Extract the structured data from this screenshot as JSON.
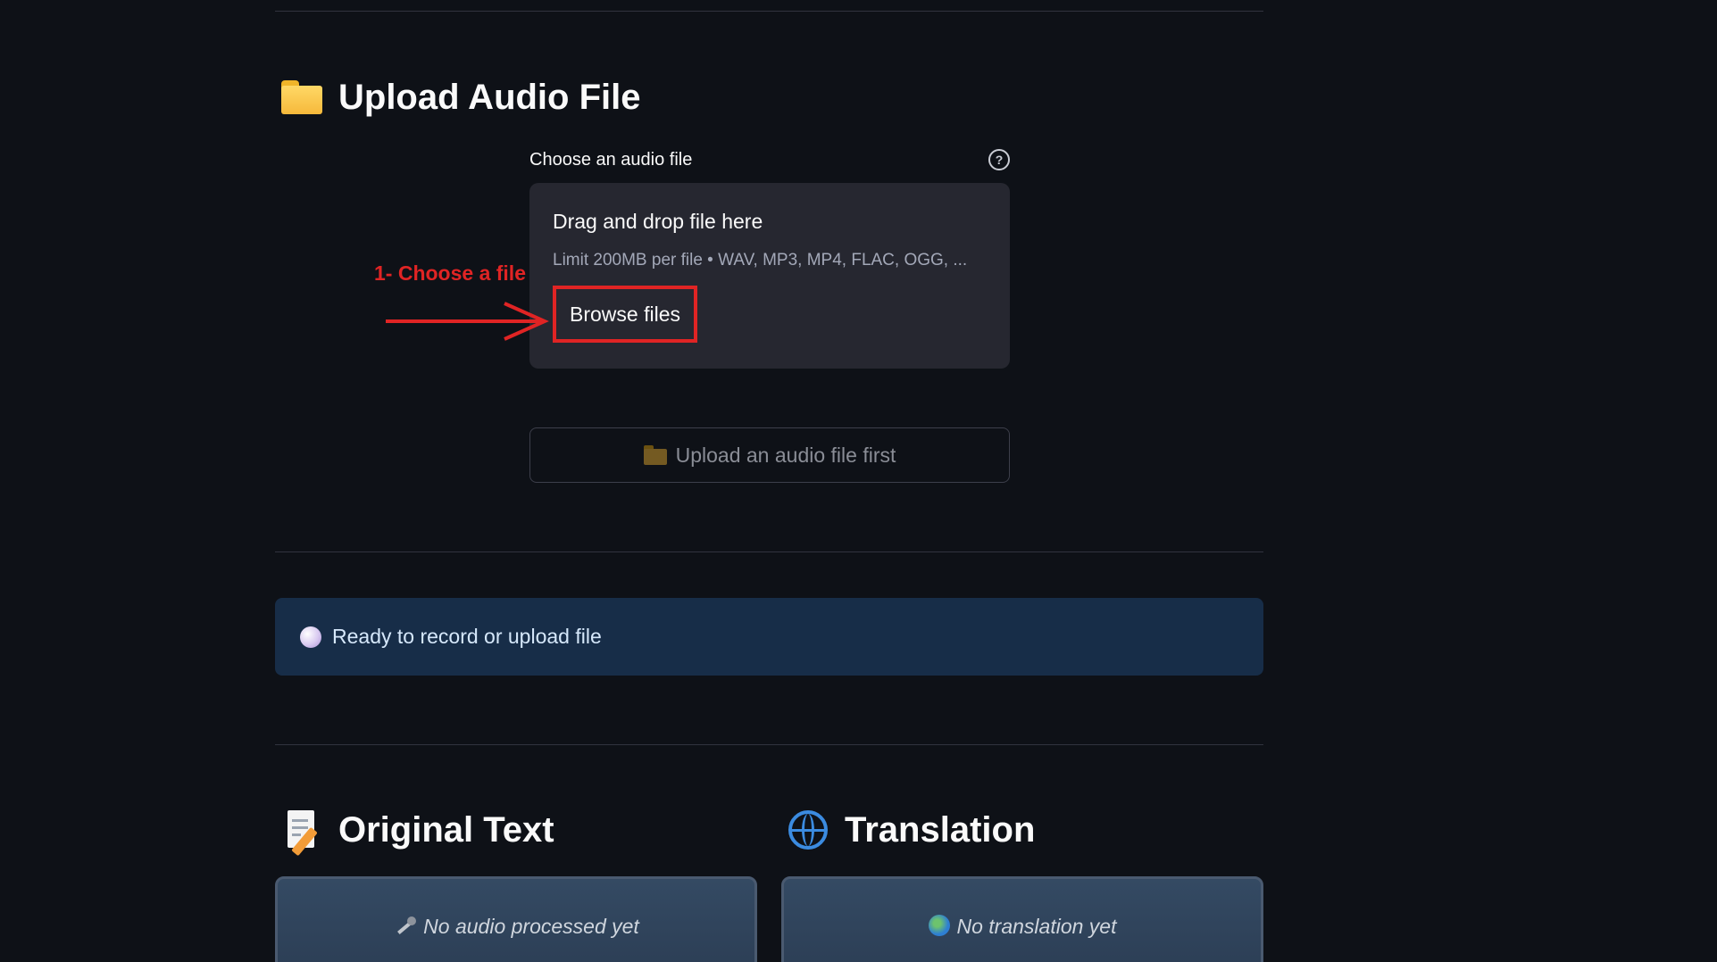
{
  "upload_section": {
    "title": "Upload Audio File",
    "icon": "folder-icon",
    "field_label": "Choose an audio file",
    "dropzone": {
      "title": "Drag and drop file here",
      "limit": "Limit 200MB per file • WAV, MP3, MP4, FLAC, OGG, ...",
      "browse_label": "Browse files"
    },
    "annotation": "1- Choose a file",
    "upload_button_label": "Upload an audio file first"
  },
  "status": {
    "text": "Ready to record or upload file",
    "icon": "white-circle-icon"
  },
  "original_text": {
    "title": "Original Text",
    "icon": "memo-icon",
    "placeholder": "No audio processed yet"
  },
  "translation": {
    "title": "Translation",
    "icon": "globe-icon",
    "placeholder": "No translation yet"
  },
  "colors": {
    "background": "#0e1117",
    "annotation_red": "#e02424",
    "status_bg": "#172d48",
    "dropzone_bg": "#262730"
  }
}
